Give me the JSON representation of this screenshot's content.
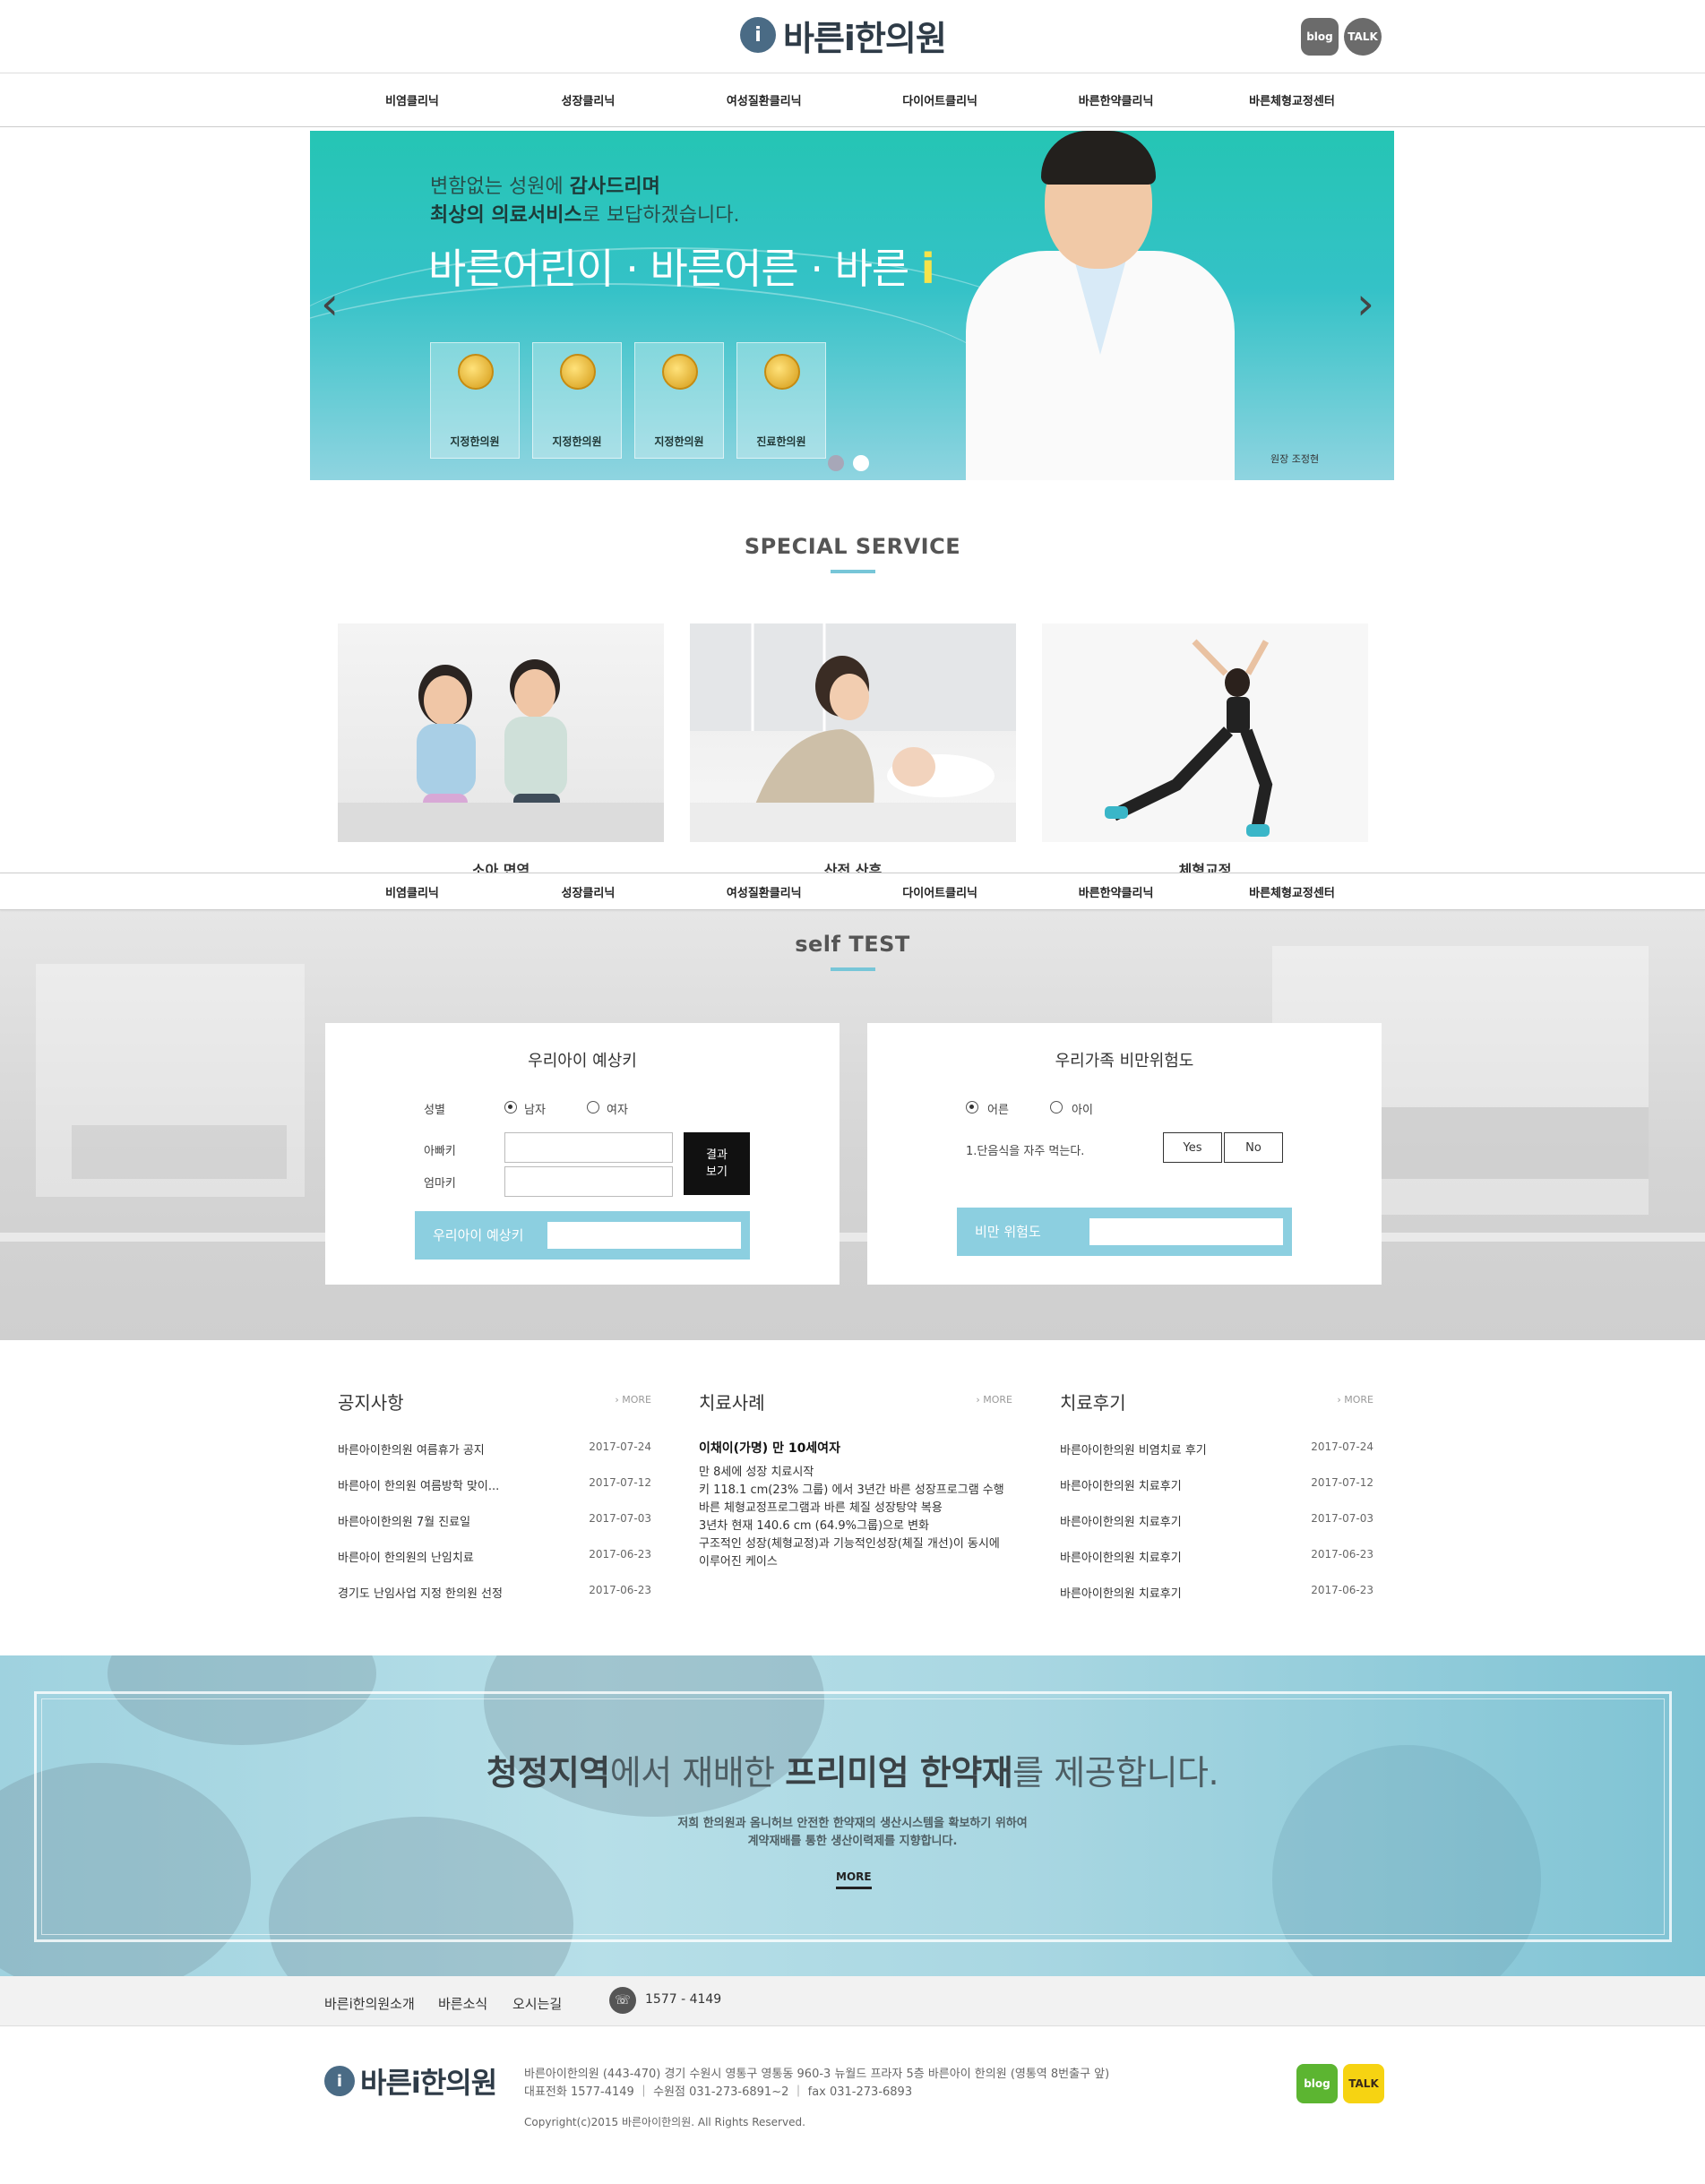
{
  "header": {
    "logo_mark": "i",
    "logo_text": "바른i한의원",
    "sns": [
      "blog",
      "TALK"
    ]
  },
  "gnb": [
    "비염클리닉",
    "성장클리닉",
    "여성질환클리닉",
    "다이어트클리닉",
    "바른한약클리닉",
    "바른체형교정센터"
  ],
  "hero": {
    "line1_a": "변함없는 성원에 ",
    "line1_b": "감사드리며",
    "line2_a": "최상의 의료서비스",
    "line2_b": "로 보답하겠습니다.",
    "slogan": "바른어린이 · 바른어른 · 바른 ",
    "slogan_i": "i",
    "badges": [
      "지정한의원",
      "지정한의원",
      "지정한의원",
      "진료한의원"
    ],
    "doctor_caption": "원장 조정현",
    "prev_icon": "chevron-left-icon",
    "next_icon": "chevron-right-icon",
    "dot_colors": [
      "#a7a7b8",
      "#ffffff"
    ]
  },
  "special": {
    "title": "SPECIAL SERVICE",
    "cards": [
      "소아 면역",
      "산전 산후",
      "체형교정"
    ]
  },
  "self_test": {
    "title": "self TEST",
    "child": {
      "title": "우리아이 예상키",
      "gender_label": "성별",
      "male": "남자",
      "female": "여자",
      "dad_label": "아빠키",
      "mom_label": "엄마키",
      "result_button": "결과\n보기",
      "result_label": "우리아이 예상키"
    },
    "family": {
      "title": "우리가족 비만위험도",
      "adult": "어른",
      "child": "아이",
      "question": "1.단음식을 자주 먹는다.",
      "yes": "Yes",
      "no": "No",
      "result_label": "비만 위험도"
    },
    "accent_color": "#8ccfe0"
  },
  "boards": {
    "notice": {
      "title": "공지사항",
      "more": "› MORE",
      "rows": [
        {
          "t": "바른아이한의원 여름휴가 공지",
          "d": "2017-07-24"
        },
        {
          "t": "바른아이 한의원 여름방학 맞이...",
          "d": "2017-07-12"
        },
        {
          "t": "바른아이한의원 7월 진료일",
          "d": "2017-07-03"
        },
        {
          "t": "바른아이 한의원의 난임치료",
          "d": "2017-06-23"
        },
        {
          "t": "경기도 난임사업 지정 한의원 선정",
          "d": "2017-06-23"
        }
      ]
    },
    "cases": {
      "title": "치료사례",
      "more": "› MORE",
      "head": "이채이(가명) 만 10세여자",
      "body": "만 8세에 성장 치료시작\n키 118.1 cm(23% 그룹) 에서 3년간 바른 성장프로그램 수행\n바른 체형교정프로그램과 바른 체질 성장탕약 복용\n3년차 현재 140.6 cm (64.9%그룹)으로 변화\n구조적인 성장(체형교정)과 기능적인성장(체질 개선)이 동시에 이루어진 케이스"
    },
    "reviews": {
      "title": "치료후기",
      "more": "› MORE",
      "rows": [
        {
          "t": "바른아이한의원 비염치료 후기",
          "d": "2017-07-24"
        },
        {
          "t": "바른아이한의원 치료후기",
          "d": "2017-07-12"
        },
        {
          "t": "바른아이한의원 치료후기",
          "d": "2017-07-03"
        },
        {
          "t": "바른아이한의원 치료후기",
          "d": "2017-06-23"
        },
        {
          "t": "바른아이한의원 치료후기",
          "d": "2017-06-23"
        }
      ]
    }
  },
  "banner": {
    "head_b1": "청정지역",
    "head_t1": "에서 재배한 ",
    "head_b2": "프리미엄 한약재",
    "head_t2": "를 제공합니다.",
    "sub1": "저희 한의원과 옴니허브 안전한 한약재의 생산시스템을 확보하기 위하여",
    "sub2": "계약재배를 통한 생산이력제를 지향합니다.",
    "more": "MORE"
  },
  "footer": {
    "nav": [
      "바른i한의원소개",
      "바른소식",
      "오시는길"
    ],
    "phone": "1577 - 4149",
    "address": "바른아이한의원 (443-470) 경기 수원시 영통구 영통동 960-3 뉴월드 프라자 5층 바른아이 한의원 (영통역 8번출구 앞)",
    "contact": "대표전화 1577-4149  ｜  수원점 031-273-6891~2  ｜  fax 031-273-6893",
    "copyright": "Copyright(c)2015 바른아이한의원. All Rights Reserved.",
    "sns": [
      "blog",
      "TALK"
    ],
    "blog_color": "#5cb531",
    "talk_color": "#f6d312"
  }
}
